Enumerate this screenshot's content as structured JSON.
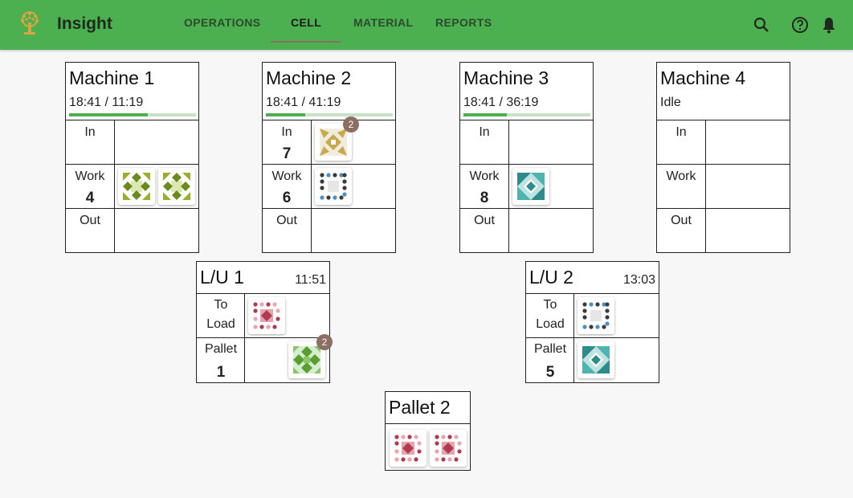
{
  "app": {
    "title": "Insight"
  },
  "nav": {
    "tabs": [
      "OPERATIONS",
      "CELL",
      "MATERIAL",
      "REPORTS"
    ],
    "active": "CELL"
  },
  "icons": {
    "logo": "tree-logo-icon",
    "search": "search-icon",
    "help": "help-icon",
    "notifications": "bell-icon"
  },
  "colors": {
    "accent": "#4caf50",
    "badge": "#8d6e63"
  },
  "machines": [
    {
      "title": "Machine 1",
      "status": "18:41 / 11:19",
      "progress": 0.62,
      "in_label": "In",
      "in_count": "",
      "work_label": "Work",
      "work_count": "4",
      "out_label": "Out"
    },
    {
      "title": "Machine 2",
      "status": "18:41 / 41:19",
      "progress": 0.31,
      "in_label": "In",
      "in_count": "7",
      "in_badge": "2",
      "work_label": "Work",
      "work_count": "6",
      "out_label": "Out"
    },
    {
      "title": "Machine 3",
      "status": "18:41 / 36:19",
      "progress": 0.34,
      "in_label": "In",
      "in_count": "",
      "work_label": "Work",
      "work_count": "8",
      "out_label": "Out"
    },
    {
      "title": "Machine 4",
      "status": "Idle",
      "in_label": "In",
      "in_count": "",
      "work_label": "Work",
      "work_count": "",
      "out_label": "Out"
    }
  ],
  "load_stations": [
    {
      "title": "L/U 1",
      "time": "11:51",
      "to_load_label_1": "To",
      "to_load_label_2": "Load",
      "pallet_label": "Pallet",
      "pallet_count": "1",
      "pallet_badge": "2"
    },
    {
      "title": "L/U 2",
      "time": "13:03",
      "to_load_label_1": "To",
      "to_load_label_2": "Load",
      "pallet_label": "Pallet",
      "pallet_count": "5"
    }
  ],
  "pallet": {
    "title": "Pallet 2"
  }
}
